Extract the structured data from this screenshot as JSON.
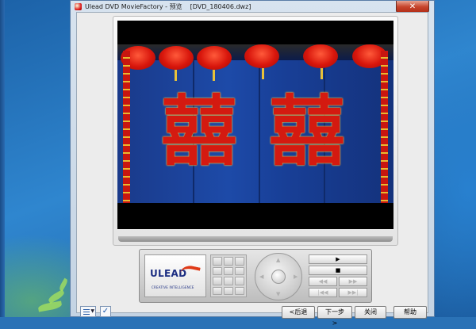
{
  "window": {
    "app_title": "Ulead DVD MovieFactory - 预览",
    "document": "[DVD_180406.dwz]",
    "close_glyph": "✕"
  },
  "console": {
    "logo": "ULEAD",
    "logo_tagline": "CREATIVE INTELLIGENCE",
    "transport": {
      "play": "▶",
      "stop": "■",
      "rewind": "◀◀",
      "fast_forward": "▶▶",
      "prev_chapter": "|◀◀",
      "next_chapter": "▶▶|",
      "frame_back": "◀|",
      "frame_forward": "|▶"
    }
  },
  "preview": {
    "characters": [
      "囍",
      "囍"
    ]
  },
  "buttons": {
    "back": "<后退",
    "next": "下一步>",
    "close": "关闭",
    "help": "帮助"
  },
  "icons": {
    "menu_list": "list-icon",
    "checkbox": "checkbox-icon"
  },
  "colors": {
    "window_frame": "#c4d3e3",
    "lantern_red": "#d8160c",
    "door_blue": "#1d4aa8"
  }
}
